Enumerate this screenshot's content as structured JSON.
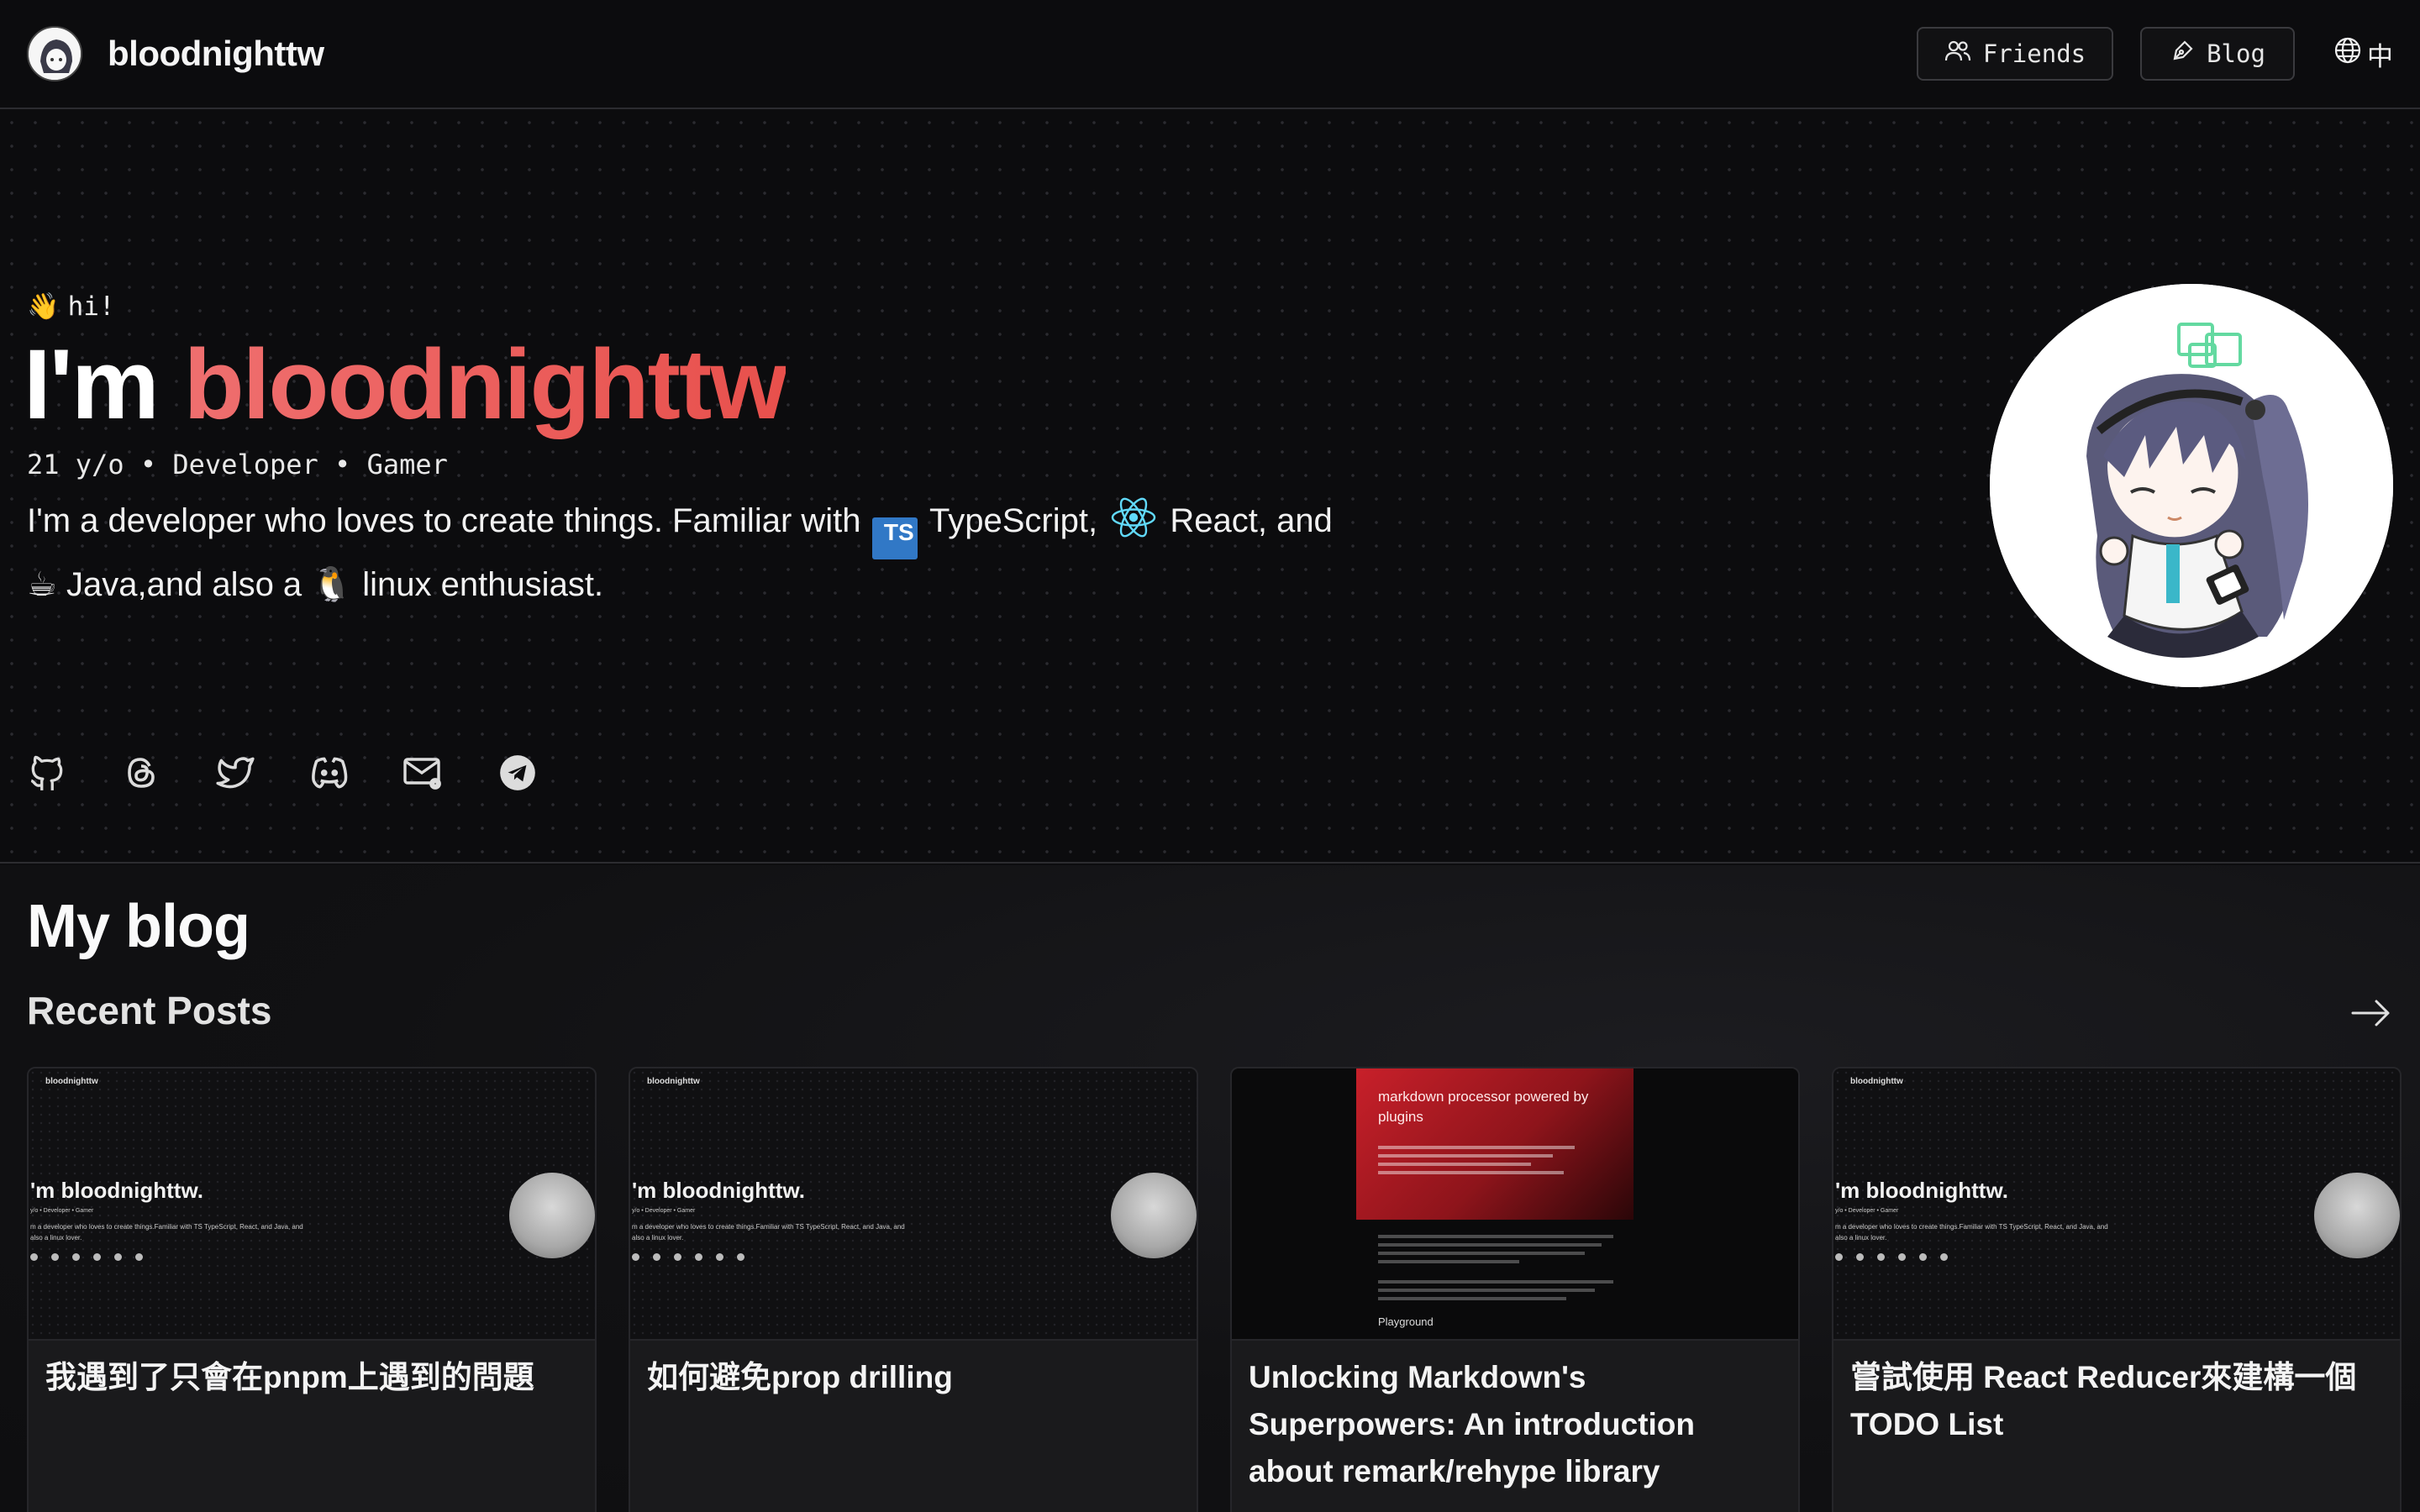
{
  "header": {
    "site_title": "bloodnighttw",
    "nav": {
      "friends_label": "Friends",
      "blog_label": "Blog",
      "language_label": "中"
    }
  },
  "hero": {
    "greeting": "hi!",
    "greeting_emoji": "👋",
    "headline_prefix": "I'm ",
    "headline_name": "bloodnighttw",
    "tagline": "21 y/o • Developer • Gamer",
    "bio": {
      "part1": "I'm a developer who loves to create things. Familiar with ",
      "ts_badge": "TS",
      "part2": " TypeScript, ",
      "part3": " React, and",
      "java_emoji": "☕",
      "part4": " Java,and also a ",
      "linux_emoji": "🐧",
      "part5": " linux enthusiast."
    },
    "socials": [
      "github-icon",
      "threads-icon",
      "twitter-icon",
      "discord-icon",
      "mail-icon",
      "telegram-icon"
    ]
  },
  "blog": {
    "section_title": "My blog",
    "recent_title": "Recent Posts",
    "posts": [
      {
        "title": "我遇到了只會在pnpm上遇到的問題",
        "thumb": {
          "site": "bloodnighttw",
          "headline": "'m bloodnighttw.",
          "sub": "y/o • Developer • Gamer",
          "bio": "m a developer who loves to create things.Familiar with TS TypeScript, React, and Java, and also a linux lover."
        }
      },
      {
        "title": "如何避免prop drilling",
        "thumb": {
          "site": "bloodnighttw",
          "headline": "'m bloodnighttw.",
          "sub": "y/o • Developer • Gamer",
          "bio": "m a developer who loves to create things.Familiar with TS TypeScript, React, and Java, and also a linux lover."
        }
      },
      {
        "title": "Unlocking Markdown's Superpowers: An introduction about remark/rehype library",
        "thumb": {
          "heading": "markdown processor powered by plugins",
          "playground": "Playground"
        }
      },
      {
        "title": "嘗試使用 React Reducer來建構一個TODO List",
        "thumb": {
          "site": "bloodnighttw",
          "headline": "'m bloodnighttw.",
          "sub": "y/o • Developer • Gamer",
          "bio": "m a developer who loves to create things.Familiar with TS TypeScript, React, and Java, and also a linux lover."
        }
      }
    ]
  },
  "colors": {
    "accent_gradient_start": "#ef6f6f",
    "accent_gradient_end": "#e8504c",
    "background": "#0d0d0f",
    "ts_blue": "#3178c6",
    "react_cyan": "#61dafb"
  }
}
